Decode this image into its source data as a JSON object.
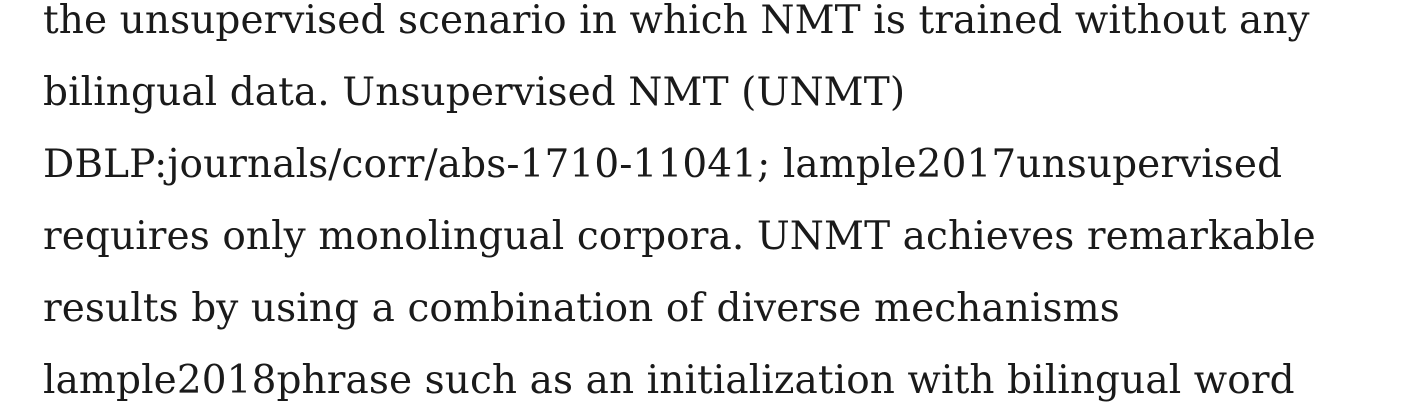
{
  "paragraph": {
    "lines": [
      "the unsupervised scenario in which NMT is trained without any",
      "bilingual data. Unsupervised NMT (UNMT)",
      "DBLP:journals/corr/abs-1710-11041; lample2017unsupervised",
      "requires only monolingual corpora. UNMT achieves remarkable",
      "results by using a combination of diverse mechanisms",
      "lample2018phrase such as an initialization with bilingual word"
    ]
  }
}
